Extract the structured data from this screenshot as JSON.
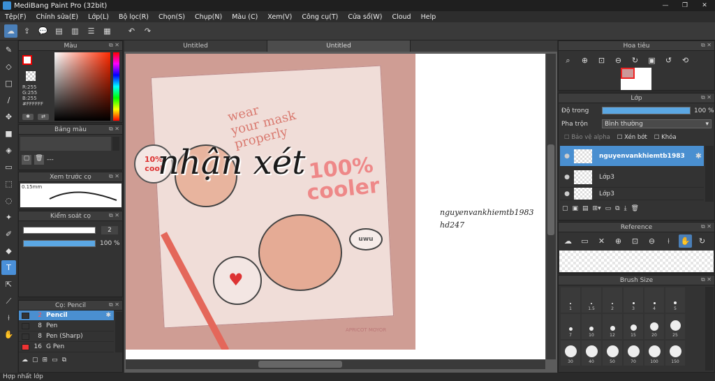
{
  "window": {
    "title": "MediBang Paint Pro (32bit)",
    "min": "—",
    "max": "❐",
    "close": "✕"
  },
  "menu": [
    "Tệp(F)",
    "Chỉnh sửa(E)",
    "Lớp(L)",
    "Bộ lọc(R)",
    "Chọn(S)",
    "Chụp(N)",
    "Màu (C)",
    "Xem(V)",
    "Công cụ(T)",
    "Cửa sổ(W)",
    "Cloud",
    "Help"
  ],
  "color_panel": {
    "title": "Màu",
    "r": "R:255",
    "g": "G:255",
    "b": "B:255",
    "hex": "#FFFFFF"
  },
  "palette_panel": {
    "title": "Bảng màu",
    "dash": "---"
  },
  "preview_panel": {
    "title": "Xem trước cọ",
    "size": "0.15mm"
  },
  "control_panel": {
    "title": "Kiểm soát cọ",
    "size_value": "2",
    "opacity_value": "100 %"
  },
  "brush_panel": {
    "title": "Cọ: Pencil",
    "items": [
      {
        "num": "2",
        "name": "Pencil"
      },
      {
        "num": "8",
        "name": "Pen"
      },
      {
        "num": "8",
        "name": "Pen (Sharp)"
      },
      {
        "num": "16",
        "name": "G Pen"
      }
    ]
  },
  "tabs": [
    "Untitled",
    "Untitled"
  ],
  "canvas": {
    "note_line1": "nguyenvankhiemtb1983",
    "note_line2": "hd247",
    "watermark": "nhận xét",
    "art_text1": "wear",
    "art_text2": "your mask",
    "art_text3": "properly",
    "art_badge": "10% cool",
    "art_big": "100% cooler",
    "art_uwu": "uwu",
    "art_sig": "APRICOT MOYOR"
  },
  "navigator": {
    "title": "Hoa tiêu"
  },
  "layer_panel": {
    "title": "Lớp",
    "opacity_label": "Độ trong",
    "opacity_value": "100 %",
    "blend_label": "Pha trộn",
    "blend_value": "Bình thường",
    "protect_alpha": "Bảo vệ alpha",
    "clip": "Xén bớt",
    "lock": "Khóa",
    "layers": [
      "nguyenvankhiemtb1983",
      "Lớp3",
      "Lớp3"
    ]
  },
  "reference_panel": {
    "title": "Reference"
  },
  "brushsize_panel": {
    "title": "Brush Size",
    "sizes": [
      "1",
      "1.5",
      "2",
      "3",
      "4",
      "5",
      "7",
      "10",
      "12",
      "15",
      "20",
      "25",
      "30",
      "40",
      "50",
      "70",
      "100",
      "150"
    ]
  },
  "status": "Hợp nhất lớp"
}
